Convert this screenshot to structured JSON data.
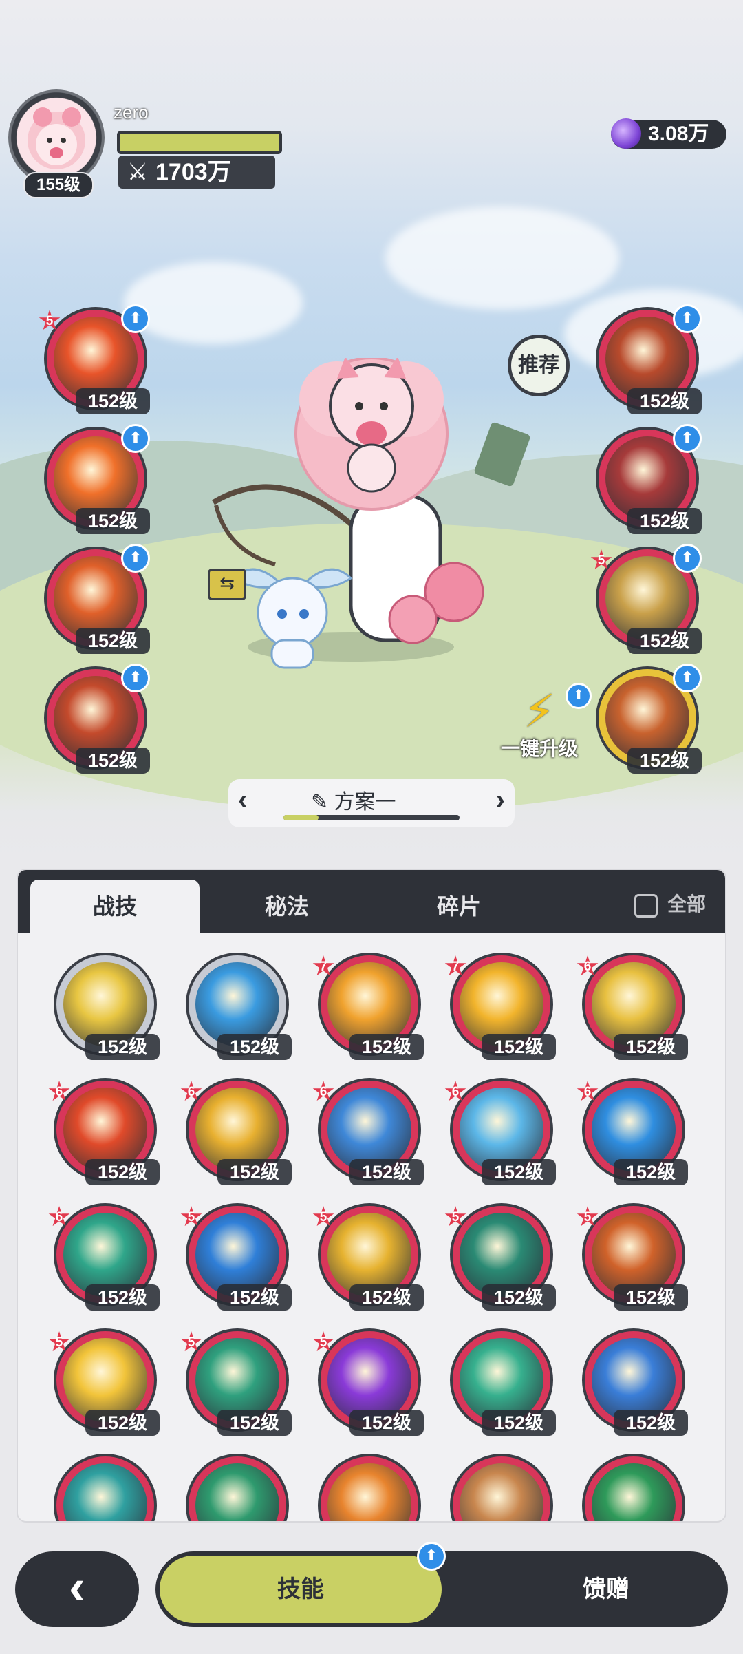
{
  "player": {
    "name": "zero",
    "level": "155级",
    "power": "1703万",
    "power_icon": "crossed-swords-icon"
  },
  "currency": {
    "amount": "3.08万",
    "icon": "purple-gem-icon"
  },
  "recommend_label": "推荐",
  "one_key_upgrade": "一键升级",
  "left_skills": [
    {
      "level": "152级",
      "star": "5",
      "color": "#e8542a"
    },
    {
      "level": "152级",
      "star": "",
      "color": "#f0702a"
    },
    {
      "level": "152级",
      "star": "",
      "color": "#e0602a"
    },
    {
      "level": "152级",
      "star": "",
      "color": "#c44a2c"
    }
  ],
  "right_skills": [
    {
      "level": "152级",
      "star": "",
      "color": "#b84a2c"
    },
    {
      "level": "152级",
      "star": "",
      "color": "#a63a3a"
    },
    {
      "level": "152级",
      "star": "5",
      "color": "#c9a04a"
    },
    {
      "level": "152级",
      "star": "",
      "color": "#c8622e"
    }
  ],
  "preset": {
    "name": "方案一",
    "progress": 0.2
  },
  "tabs": [
    "战技",
    "秘法",
    "碎片"
  ],
  "all_label": "全部",
  "grid_rows": [
    [
      {
        "level": "152级",
        "star": "",
        "color": "#e8c642",
        "tier": "silver"
      },
      {
        "level": "152级",
        "star": "",
        "color": "#3a9be0",
        "tier": "silver"
      },
      {
        "level": "152级",
        "star": "7",
        "color": "#f0a22e",
        "tier": "red"
      },
      {
        "level": "152级",
        "star": "7",
        "color": "#f2b42c",
        "tier": "red"
      },
      {
        "level": "152级",
        "star": "6",
        "color": "#e8c040",
        "tier": "red"
      }
    ],
    [
      {
        "level": "152级",
        "star": "6",
        "color": "#e04a2a",
        "tier": "red"
      },
      {
        "level": "152级",
        "star": "6",
        "color": "#e8b030",
        "tier": "red"
      },
      {
        "level": "152级",
        "star": "6",
        "color": "#3f88d8",
        "tier": "red"
      },
      {
        "level": "152级",
        "star": "6",
        "color": "#5cb7e8",
        "tier": "red"
      },
      {
        "level": "152级",
        "star": "6",
        "color": "#2f8ee0",
        "tier": "red"
      }
    ],
    [
      {
        "level": "152级",
        "star": "6",
        "color": "#2fa68a",
        "tier": "red"
      },
      {
        "level": "152级",
        "star": "5",
        "color": "#2f7fd8",
        "tier": "red"
      },
      {
        "level": "152级",
        "star": "5",
        "color": "#e6b230",
        "tier": "red"
      },
      {
        "level": "152级",
        "star": "5",
        "color": "#2a8a74",
        "tier": "red"
      },
      {
        "level": "152级",
        "star": "5",
        "color": "#d0622a",
        "tier": "red"
      }
    ],
    [
      {
        "level": "152级",
        "star": "5",
        "color": "#f2c43a",
        "tier": "red"
      },
      {
        "level": "152级",
        "star": "5",
        "color": "#2fa07e",
        "tier": "red"
      },
      {
        "level": "152级",
        "star": "5",
        "color": "#8a3ad8",
        "tier": "red"
      },
      {
        "level": "152级",
        "star": "",
        "color": "#36b08e",
        "tier": "red"
      },
      {
        "level": "152级",
        "star": "",
        "color": "#3a7ed8",
        "tier": "red"
      }
    ],
    [
      {
        "level": "",
        "star": "",
        "color": "#2fa0a0",
        "tier": "red"
      },
      {
        "level": "",
        "star": "",
        "color": "#2e9a6e",
        "tier": "red"
      },
      {
        "level": "",
        "star": "",
        "color": "#e8842e",
        "tier": "red"
      },
      {
        "level": "",
        "star": "",
        "color": "#c8864e",
        "tier": "red"
      },
      {
        "level": "",
        "star": "",
        "color": "#2e9a5a",
        "tier": "red"
      }
    ]
  ],
  "bottom_nav": {
    "back_icon": "back-arrow-icon",
    "skill_label": "技能",
    "gift_label": "馈赠"
  }
}
